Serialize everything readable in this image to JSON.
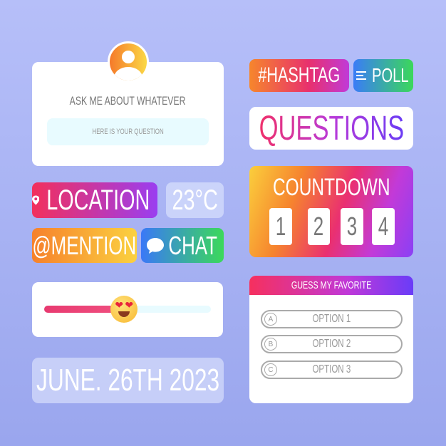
{
  "question_box": {
    "title": "ASK ME ABOUT WHATEVER",
    "placeholder": "HERE IS YOUR QUESTION",
    "avatar_icon": "user-icon"
  },
  "location": {
    "label": "LOCATION",
    "icon": "map-pin-icon"
  },
  "temperature": {
    "value": "23°C"
  },
  "mention": {
    "label": "@MENTION"
  },
  "chat": {
    "label": "CHAT",
    "icon": "chat-bubble-icon"
  },
  "slider": {
    "emoji": "heart-eyes-emoji-icon",
    "value_percent": 48
  },
  "date": {
    "text": "JUNE. 26TH 2023"
  },
  "hashtag": {
    "label": "#HASHTAG"
  },
  "poll": {
    "label": "POLL",
    "icon": "list-icon"
  },
  "questions": {
    "label": "QUESTIONS"
  },
  "countdown": {
    "title": "COUNTDOWN",
    "digits": [
      "1",
      "2",
      "3",
      "4"
    ]
  },
  "quiz": {
    "title": "GUESS MY FAVORITE",
    "options": [
      {
        "letter": "A",
        "label": "OPTION 1"
      },
      {
        "letter": "B",
        "label": "OPTION 2"
      },
      {
        "letter": "C",
        "label": "OPTION 3"
      }
    ]
  },
  "colors": {
    "pink": "#f0306a",
    "purple": "#7a3cf5",
    "orange": "#f7862c",
    "yellow": "#fcd33f",
    "blue": "#3a7cf7",
    "green": "#38d65a"
  }
}
